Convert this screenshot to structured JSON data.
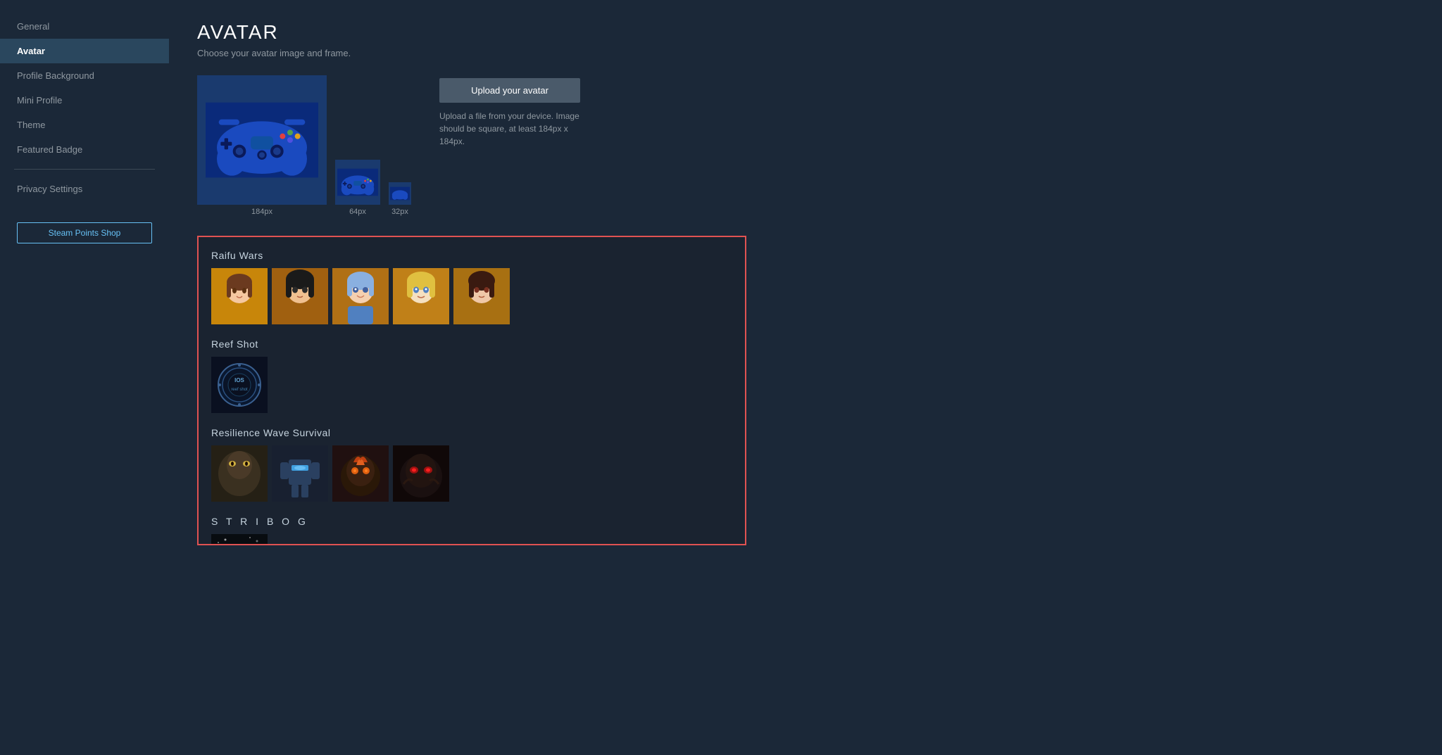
{
  "sidebar": {
    "items": [
      {
        "id": "general",
        "label": "General",
        "active": false
      },
      {
        "id": "avatar",
        "label": "Avatar",
        "active": true
      },
      {
        "id": "profile-background",
        "label": "Profile Background",
        "active": false
      },
      {
        "id": "mini-profile",
        "label": "Mini Profile",
        "active": false
      },
      {
        "id": "theme",
        "label": "Theme",
        "active": false
      },
      {
        "id": "featured-badge",
        "label": "Featured Badge",
        "active": false
      },
      {
        "id": "privacy-settings",
        "label": "Privacy Settings",
        "active": false
      }
    ],
    "steam_points_btn": "Steam Points Shop"
  },
  "page": {
    "title": "AVATAR",
    "subtitle": "Choose your avatar image and frame."
  },
  "avatar_sizes": [
    {
      "id": "large",
      "size": "184px"
    },
    {
      "id": "medium",
      "size": "64px"
    },
    {
      "id": "small",
      "size": "32px"
    }
  ],
  "upload": {
    "button_label": "Upload your avatar",
    "hint": "Upload a file from your device. Image should be square, at least 184px x 184px."
  },
  "gallery": {
    "sections": [
      {
        "id": "raifu-wars",
        "title": "Raifu Wars",
        "spaced": false,
        "items": [
          {
            "id": "rw1",
            "css_class": "raifu-1"
          },
          {
            "id": "rw2",
            "css_class": "raifu-2"
          },
          {
            "id": "rw3",
            "css_class": "raifu-3"
          },
          {
            "id": "rw4",
            "css_class": "raifu-4"
          },
          {
            "id": "rw5",
            "css_class": "raifu-5"
          }
        ]
      },
      {
        "id": "reef-shot",
        "title": "Reef Shot",
        "spaced": false,
        "items": [
          {
            "id": "rs1",
            "css_class": "reef-1"
          }
        ]
      },
      {
        "id": "resilience-wave-survival",
        "title": "Resilience Wave Survival",
        "spaced": false,
        "items": [
          {
            "id": "rws1",
            "css_class": "rws-1"
          },
          {
            "id": "rws2",
            "css_class": "rws-2"
          },
          {
            "id": "rws3",
            "css_class": "rws-3"
          },
          {
            "id": "rws4",
            "css_class": "rws-4"
          }
        ]
      },
      {
        "id": "stribog",
        "title": "S T R I B O G",
        "spaced": true,
        "items": [
          {
            "id": "strib1",
            "css_class": "stribog-1"
          }
        ]
      }
    ]
  }
}
